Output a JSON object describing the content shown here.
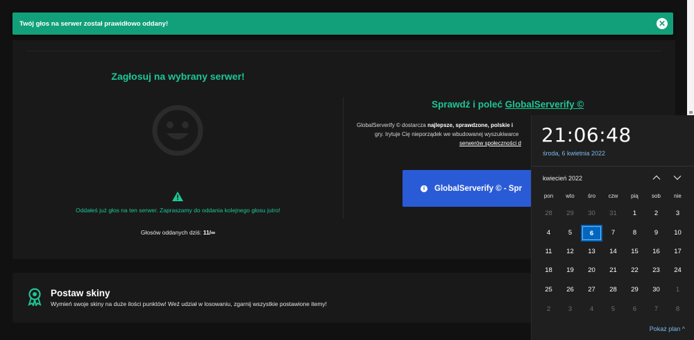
{
  "toast": {
    "message": "Twój głos na serwer został prawidłowo oddany!",
    "close_glyph": "✕"
  },
  "vote": {
    "title": "Zagłosuj na wybrany serwer!",
    "voted_message": "Oddałeś już głos na ten serwer. Zapraszamy do oddania kolejnego głosu jutro!",
    "votes_today_label": "Głosów oddanych dziś:",
    "votes_today_value": "11/∞"
  },
  "promo": {
    "title_prefix": "Sprawdź i poleć",
    "title_link": "GlobalServerify ©",
    "line1_prefix": "GlobalServerify © dostarcza",
    "line1_bold": "najlepsze, sprawdzone, polskie i",
    "line2": "gry. Irytuje Cię nieporządek we wbudowanej wyszukiwarce",
    "line3_link": "serwerów społeczności d",
    "button_label": "GlobalServerify © - Spr",
    "button_icon": "info-circle-icon"
  },
  "skins": {
    "title": "Postaw skiny",
    "description": "Wymień swoje skiny na duże ilości punktów! Weź udział w losowaniu, zgarnij wszystkie postawione itemy!",
    "icon": "award-ribbon-icon"
  },
  "clock": {
    "time": "21:06:48",
    "date": "środa, 6 kwietnia 2022",
    "month_label": "kwiecień 2022",
    "weekdays": [
      "pon",
      "wto",
      "śro",
      "czw",
      "pią",
      "sob",
      "nie"
    ],
    "weeks": [
      [
        {
          "d": "28",
          "o": true
        },
        {
          "d": "29",
          "o": true
        },
        {
          "d": "30",
          "o": true
        },
        {
          "d": "31",
          "o": true
        },
        {
          "d": "1"
        },
        {
          "d": "2"
        },
        {
          "d": "3"
        }
      ],
      [
        {
          "d": "4"
        },
        {
          "d": "5"
        },
        {
          "d": "6",
          "t": true
        },
        {
          "d": "7"
        },
        {
          "d": "8"
        },
        {
          "d": "9"
        },
        {
          "d": "10"
        }
      ],
      [
        {
          "d": "11"
        },
        {
          "d": "12"
        },
        {
          "d": "13"
        },
        {
          "d": "14"
        },
        {
          "d": "15"
        },
        {
          "d": "16"
        },
        {
          "d": "17"
        }
      ],
      [
        {
          "d": "18"
        },
        {
          "d": "19"
        },
        {
          "d": "20"
        },
        {
          "d": "21"
        },
        {
          "d": "22"
        },
        {
          "d": "23"
        },
        {
          "d": "24"
        }
      ],
      [
        {
          "d": "25"
        },
        {
          "d": "26"
        },
        {
          "d": "27"
        },
        {
          "d": "28"
        },
        {
          "d": "29"
        },
        {
          "d": "30"
        },
        {
          "d": "1",
          "o": true
        }
      ],
      [
        {
          "d": "2",
          "o": true
        },
        {
          "d": "3",
          "o": true
        },
        {
          "d": "4",
          "o": true
        },
        {
          "d": "5",
          "o": true
        },
        {
          "d": "6",
          "o": true
        },
        {
          "d": "7",
          "o": true
        },
        {
          "d": "8",
          "o": true
        }
      ]
    ],
    "show_plan_label": "Pokaż plan",
    "show_plan_chevron": "^"
  },
  "colors": {
    "accent": "#1ec695",
    "toast": "#11a07a",
    "button": "#2a5bd7",
    "calendar_today": "#0067c0"
  }
}
